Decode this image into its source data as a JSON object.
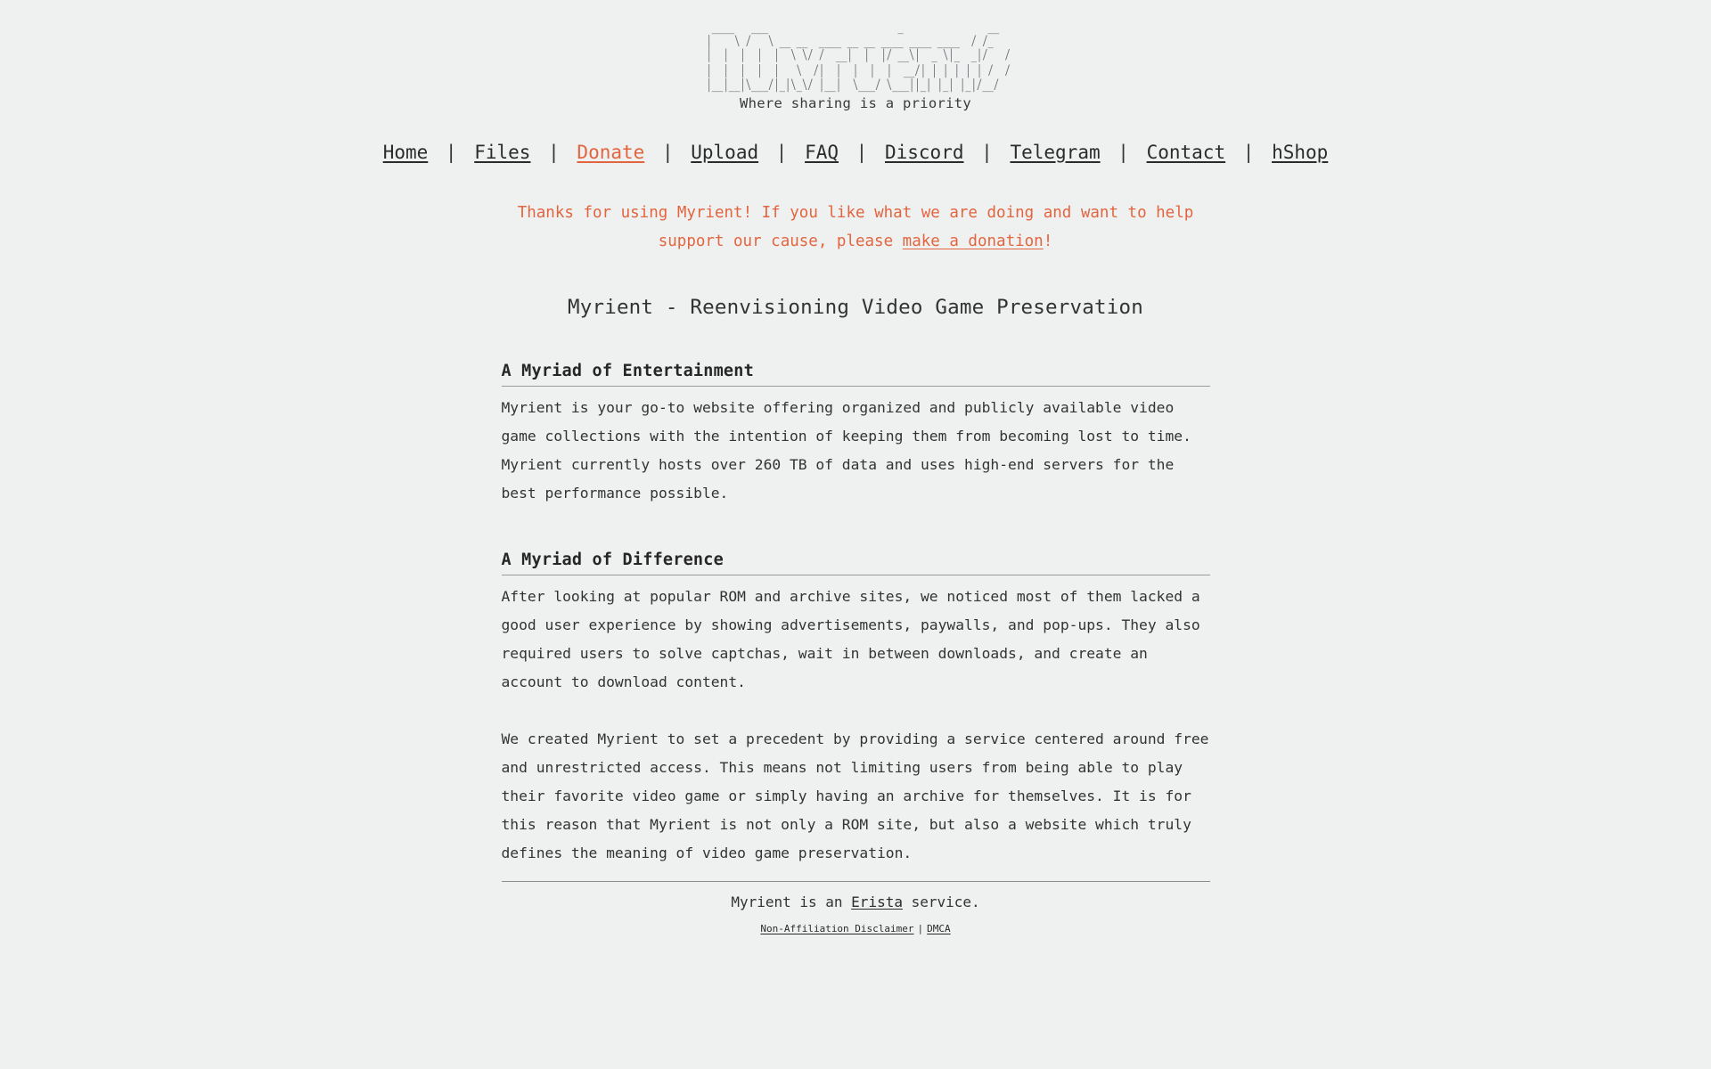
{
  "site": {
    "logo_ascii_name": "myrient-ascii-logo",
    "logo_text": "Myrient",
    "logo_ascii": "  ____   ___                       _               __ \n |    \\ /   \\ __ __  ____ __ __ ____ ____ ____  / /_\n |  |  |  |  |  \\ \\/ /  __|  |  |/ __\\|  _ \\|_  _|/   /\n |  |  |  |  |   \\  /|  |  |  |  |  __/| | | | | | /  /\n |__|__|\\___/|_|\\_\\/ |__|  \\___/ \\___||_| |_| |_|/__/ ",
    "tagline": "Where sharing is a priority"
  },
  "nav": {
    "row1": [
      {
        "label": "Home",
        "accent": false
      },
      {
        "label": "Files",
        "accent": false
      },
      {
        "label": "Donate",
        "accent": true
      },
      {
        "label": "Upload",
        "accent": false
      },
      {
        "label": "FAQ",
        "accent": false
      },
      {
        "label": "Discord",
        "accent": false
      },
      {
        "label": "Telegram",
        "accent": false
      }
    ],
    "row2": [
      {
        "label": "Contact",
        "accent": false
      },
      {
        "label": "hShop",
        "accent": false
      }
    ],
    "separator": "|",
    "trailing_separator": "|"
  },
  "banner": {
    "text_before": "Thanks for using Myrient! If you like what we are doing and want to help support our cause, please ",
    "link_label": "make a donation",
    "text_after": "!",
    "color": "#e2653f"
  },
  "page_title": "Myrient - Reenvisioning Video Game Preservation",
  "sections": [
    {
      "heading": "A Myriad of Entertainment",
      "paragraphs": [
        "Myrient is your go-to website offering organized and publicly available video game collections with the intention of keeping them from becoming lost to time. Myrient currently hosts over 260 TB of data and uses high-end servers for the best performance possible."
      ]
    },
    {
      "heading": "A Myriad of Difference",
      "paragraphs": [
        "After looking at popular ROM and archive sites, we noticed most of them lacked a good user experience by showing advertisements, paywalls, and pop-ups. They also required users to solve captchas, wait in between downloads, and create an account to download content.",
        "We created Myrient to set a precedent by providing a service centered around free and unrestricted access. This means not limiting users from being able to play their favorite video game or simply having an archive for themselves. It is for this reason that Myrient is not only a ROM site, but also a website which truly defines the meaning of video game preservation."
      ]
    }
  ],
  "footer": {
    "main_before": "Myrient is an ",
    "main_link": "Erista",
    "main_after": " service.",
    "links": [
      {
        "label": "Non-Affiliation Disclaimer"
      },
      {
        "label": "DMCA"
      }
    ],
    "separator": "|"
  },
  "colors": {
    "background": "#eff0f0",
    "text": "#333333",
    "accent": "#e2653f",
    "rule": "#9a9a9a",
    "logo": "#6f7478"
  }
}
